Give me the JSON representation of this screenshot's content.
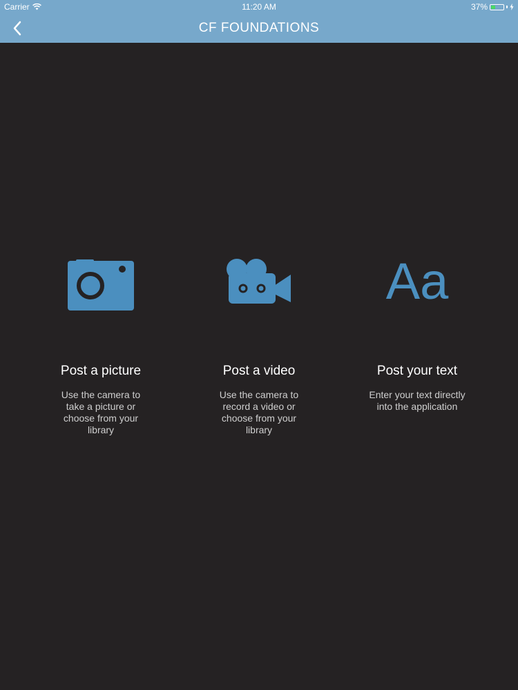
{
  "status_bar": {
    "carrier": "Carrier",
    "time": "11:20 AM",
    "battery_percent": "37%",
    "battery_level": 0.37,
    "wifi_icon": "wifi-icon",
    "charging_icon": "charging-icon"
  },
  "nav": {
    "title": "CF FOUNDATIONS",
    "back_icon": "chevron-left-icon"
  },
  "colors": {
    "header": "#77a8cb",
    "background": "#252223",
    "icon": "#4b8fbf",
    "battery": "#4cd964"
  },
  "options": [
    {
      "icon": "camera-icon",
      "title": "Post a picture",
      "description": "Use the camera to take a picture or choose from your library"
    },
    {
      "icon": "video-camera-icon",
      "title": "Post a video",
      "description": "Use the camera to record a video or choose from your library"
    },
    {
      "icon": "text-icon",
      "icon_text": "Aa",
      "title": "Post your text",
      "description": "Enter your text directly into the application"
    }
  ]
}
